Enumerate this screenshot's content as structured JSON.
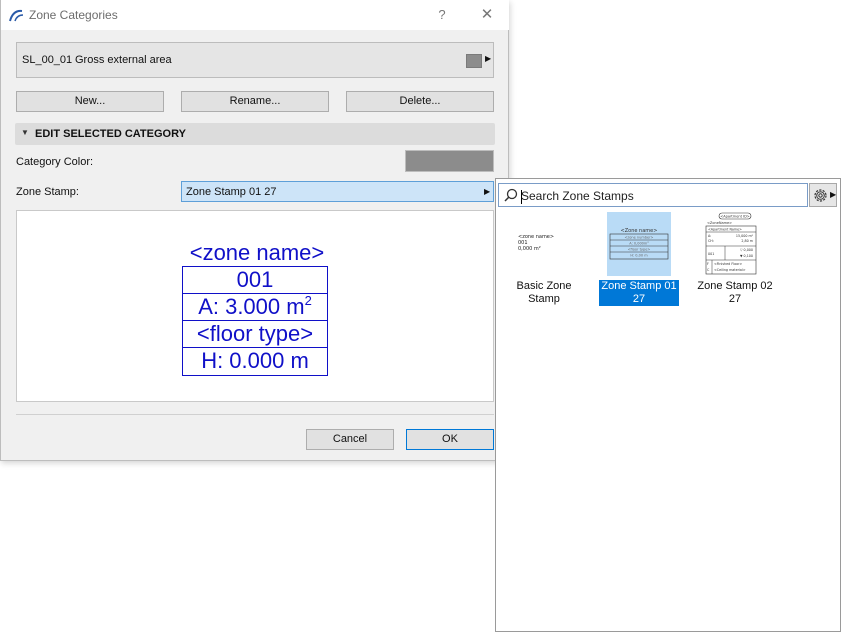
{
  "dialog": {
    "title": "Zone Categories",
    "help_label": "?",
    "close_label": "✕",
    "category": {
      "id": "SL_00_01",
      "name": "Gross external area"
    },
    "buttons": {
      "new": "New...",
      "rename": "Rename...",
      "delete": "Delete..."
    },
    "section_title": "EDIT SELECTED CATEGORY",
    "category_color_label": "Category Color:",
    "category_color": "#8c8c8c",
    "zone_stamp_label": "Zone Stamp:",
    "zone_stamp_value": "Zone Stamp 01 27",
    "preview": {
      "zone_name": "<zone name>",
      "number": "001",
      "area": "A: 3.000 m",
      "area_exp": "2",
      "floor_type": "<floor type>",
      "height": "H: 0.000 m"
    },
    "cancel": "Cancel",
    "ok": "OK"
  },
  "picker": {
    "search_placeholder": "Search Zone Stamps",
    "tiles": [
      {
        "label": "Basic Zone Stamp",
        "selected": false
      },
      {
        "label": "Zone Stamp 01 27",
        "selected": true
      },
      {
        "label": "Zone Stamp 02 27",
        "selected": false
      }
    ]
  },
  "colors": {
    "accent": "#0078d7",
    "stamp_blue": "#1010c8",
    "selection_fill": "#cde4f8"
  }
}
